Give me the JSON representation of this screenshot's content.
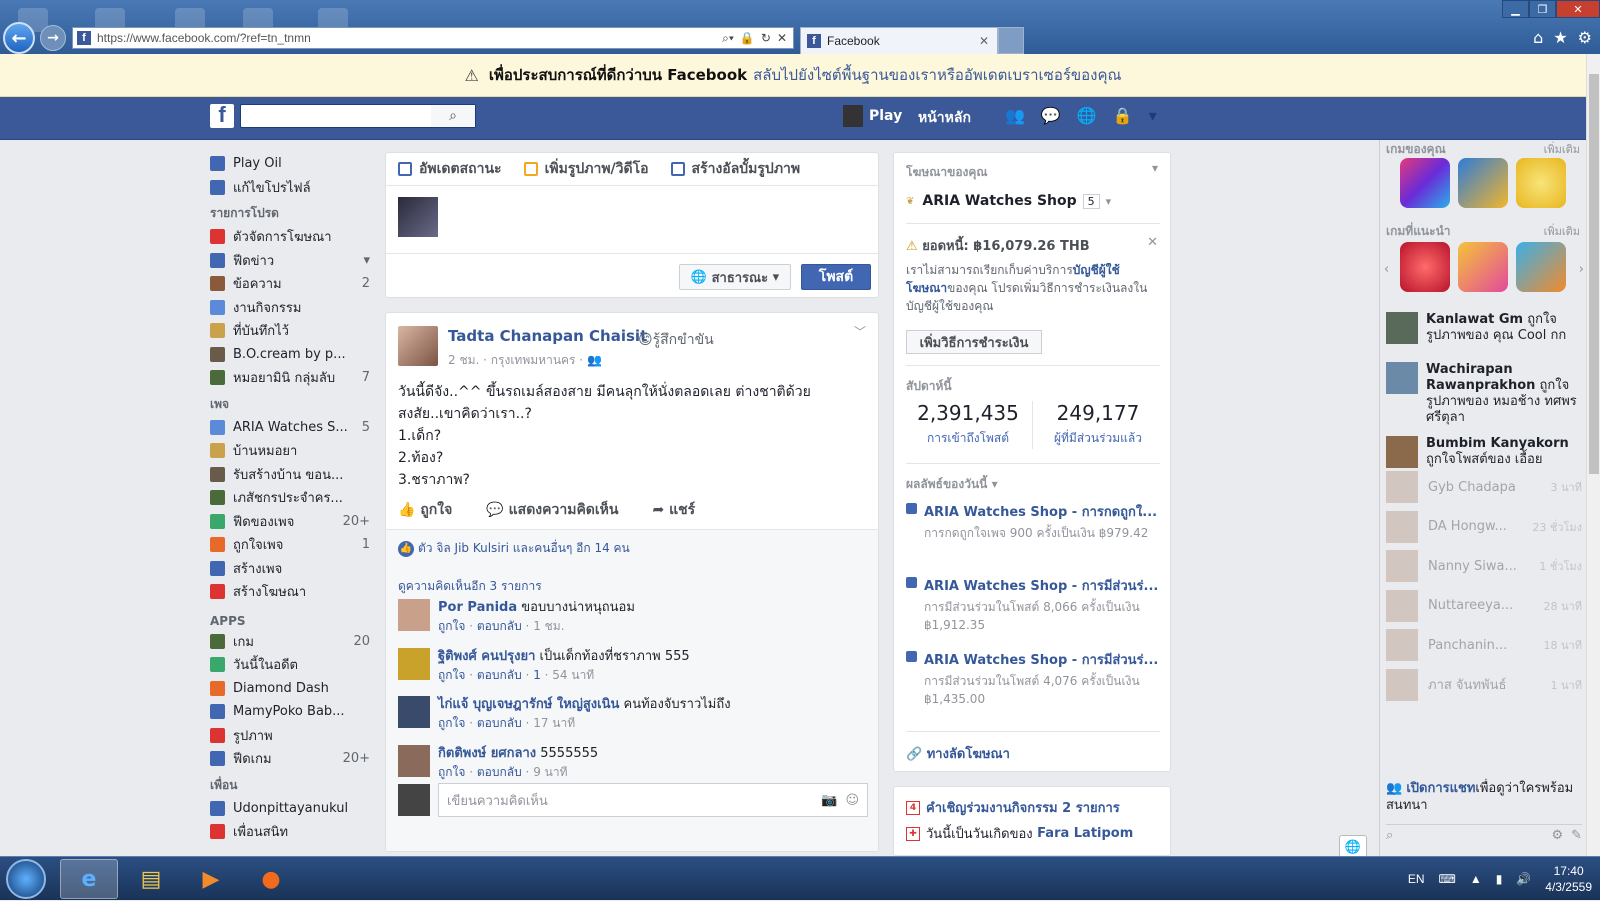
{
  "browser": {
    "url": "https://www.facebook.com/?ref=tn_tnmn",
    "tab_title": "Facebook"
  },
  "warning": {
    "text": "เพื่อประสบการณ์ที่ดีกว่าบน Facebook",
    "link": "สลับไปยังไซต์พื้นฐานของเราหรืออัพเดตเบราเซอร์ของคุณ"
  },
  "header": {
    "play": "Play",
    "home": "หน้าหลัก"
  },
  "leftnav": {
    "top": [
      {
        "label": "Play Oil",
        "count": ""
      },
      {
        "label": "แก้ไขโปรไฟล์",
        "count": ""
      }
    ],
    "favorites_title": "รายการโปรด",
    "favorites": [
      {
        "label": "ตัวจัดการโฆษณา",
        "count": ""
      },
      {
        "label": "ฟีดข่าว",
        "count": "▾"
      },
      {
        "label": "ข้อความ",
        "count": "2"
      },
      {
        "label": "งานกิจกรรม",
        "count": ""
      },
      {
        "label": "ที่บันทึกไว้",
        "count": ""
      },
      {
        "label": "B.O.cream by p...",
        "count": ""
      },
      {
        "label": "หมอยามินิ กลุ่มลับ",
        "count": "7"
      }
    ],
    "pages_title": "เพจ",
    "pages": [
      {
        "label": "ARIA Watches S...",
        "count": "5"
      },
      {
        "label": "บ้านหมอยา",
        "count": ""
      },
      {
        "label": "รับสร้างบ้าน ขอน...",
        "count": ""
      },
      {
        "label": "เภสัชกรประจำคร...",
        "count": ""
      },
      {
        "label": "ฟีดของเพจ",
        "count": "20+"
      },
      {
        "label": "ถูกใจเพจ",
        "count": "1"
      },
      {
        "label": "สร้างเพจ",
        "count": ""
      },
      {
        "label": "สร้างโฆษณา",
        "count": ""
      }
    ],
    "apps_title": "APPS",
    "apps": [
      {
        "label": "เกม",
        "count": "20"
      },
      {
        "label": "วันนี้ในอดีต",
        "count": ""
      },
      {
        "label": "Diamond Dash",
        "count": ""
      },
      {
        "label": "MamyPoko Bab...",
        "count": ""
      },
      {
        "label": "รูปภาพ",
        "count": ""
      },
      {
        "label": "ฟีดเกม",
        "count": "20+"
      }
    ],
    "friends_title": "เพื่อน",
    "friends": [
      {
        "label": "Udonpittayanukul",
        "count": ""
      },
      {
        "label": "เพื่อนสนิท",
        "count": ""
      }
    ]
  },
  "composer": {
    "tab_status": "อัพเดตสถานะ",
    "tab_photo": "เพิ่มรูปภาพ/วิดีโอ",
    "tab_album": "สร้างอัลบั้มรูปภาพ",
    "audience": "สาธารณะ",
    "post": "โพสต์"
  },
  "post": {
    "author": "Tadta Chanapan Chaisit",
    "feeling": "รู้สึกขำขัน",
    "meta": "2 ชม. · กรุงเทพมหานคร ·",
    "text": [
      "วันนี้ดีจัง..^^ ขึ้นรถเมล์สองสาย มีคนลุกให้นั่งตลอดเลย ต่างชาติด้วย",
      "สงสัย..เขาคิดว่าเรา..?",
      "1.เด็ก?",
      "2.ท้อง?",
      "3.ชราภาพ?"
    ],
    "like": "ถูกใจ",
    "comment": "แสดงความคิดเห็น",
    "share": "แชร์",
    "likes_text": "ตัว จิล Jib Kulsiri และคนอื่นๆ อีก 14 คน",
    "more_comments": "ดูความคิดเห็นอีก 3 รายการ",
    "comments": [
      {
        "name": "Por Panida",
        "text": "ขอบบางน่าหนุถนอม",
        "like": "ถูกใจ",
        "reply": "ตอบกลับ",
        "time": "1 ชม.",
        "likes": ""
      },
      {
        "name": "ฐิติพงศ์ คนปรุงยา",
        "text": "เป็นเด็กท้องที่ชราภาพ 555",
        "like": "ถูกใจ",
        "reply": "ตอบกลับ",
        "time": "54 นาที",
        "likes": "1"
      },
      {
        "name": "ไก่แจ้ บุญเจษฎารักษ์ ใหญ่สูงเนิน",
        "text": "คนท้องจับราวไม่ถึง",
        "like": "ถูกใจ",
        "reply": "ตอบกลับ",
        "time": "17 นาที",
        "likes": ""
      },
      {
        "name": "กิตติพงษ์ ยศกลาง",
        "text": "5555555",
        "like": "ถูกใจ",
        "reply": "ตอบกลับ",
        "time": "9 นาที",
        "likes": ""
      }
    ],
    "comment_placeholder": "เขียนความคิดเห็น"
  },
  "ads": {
    "title": "โฆษณาของคุณ",
    "page": "ARIA Watches Shop",
    "page_count": "5",
    "balance": "ยอดหนี้: ฿16,079.26 THB",
    "balance_text_1": "เราไม่สามารถเรียกเก็บค่าบริการ",
    "balance_link": "บัญชีผู้ใช้โฆษณา",
    "balance_text_2": "ของคุณ โปรดเพิ่มวิธีการชำระเงินลงในบัญชีผู้ใช้ของคุณ",
    "pay_button": "เพิ่มวิธีการชำระเงิน",
    "week_title": "สัปดาห์นี้",
    "reach": "2,391,435",
    "reach_label": "การเข้าถึงโพสต์",
    "engaged": "249,177",
    "engaged_label": "ผู้ที่มีส่วนร่วมแล้ว",
    "today_title": "ผลลัพธ์ของวันนี้",
    "results": [
      {
        "title": "ARIA Watches Shop - การกดถูกใ...",
        "desc": "การกดถูกใจเพจ 900 ครั้งเป็นเงิน ฿979.42"
      },
      {
        "title": "ARIA Watches Shop - การมีส่วนร่...",
        "desc": "การมีส่วนร่วมในโพสต์ 8,066 ครั้งเป็นเงิน ฿1,912.35"
      },
      {
        "title": "ARIA Watches Shop - การมีส่วนร่...",
        "desc": "การมีส่วนร่วมในโพสต์ 4,076 ครั้งเป็นเงิน ฿1,435.00"
      }
    ],
    "shortcut": "ทางลัดโฆษณา"
  },
  "events": {
    "invites": "คำเชิญร่วมงานกิจกรรม 2 รายการ",
    "birthday_prefix": "วันนี้เป็นวันเกิดของ",
    "birthday_name": "Fara Latipom"
  },
  "rightbar": {
    "games_title": "เกมของคุณ",
    "see_more": "เพิ่มเติม",
    "suggested_title": "เกมที่แนะนำ",
    "ticker": [
      {
        "name": "Kanlawat Gm",
        "text": "ถูกใจรูปภาพของ คุณ Cool กก"
      },
      {
        "name": "Wachirapan Rawanprakhon",
        "text": "ถูกใจรูปภาพของ หมอช้าง ทศพร ศรีตุลา"
      },
      {
        "name": "Bumbim Kanyakorn",
        "text": "ถูกใจโพสต์ของ เอื้อย"
      }
    ],
    "chats": [
      {
        "name": "Gyb Chadapa",
        "time": "3 นาที"
      },
      {
        "name": "DA Hongw...",
        "time": "23 ชั่วโมง"
      },
      {
        "name": "Nanny Siwa...",
        "time": "1 ชั่วโมง"
      },
      {
        "name": "Nuttareeya...",
        "time": "28 นาที"
      },
      {
        "name": "Panchanin...",
        "time": "18 นาที"
      },
      {
        "name": "ภาส จันทพันธ์",
        "time": "1 นาที"
      }
    ],
    "chat_open_link": "เปิดการแชท",
    "chat_open_text": "เพื่อดูว่าใครพร้อมสนทนา"
  },
  "taskbar": {
    "lang": "EN",
    "time": "17:40",
    "date": "4/3/2559"
  }
}
